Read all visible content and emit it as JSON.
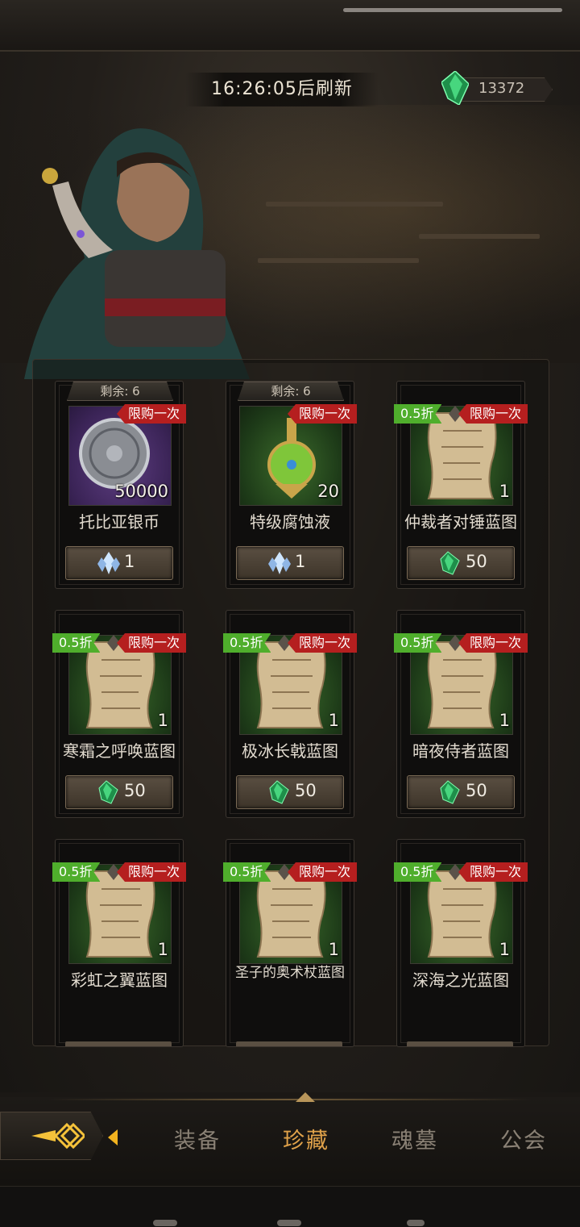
{
  "header": {
    "refresh_timer": "16:26:05后刷新",
    "gem_count": "13372"
  },
  "colors": {
    "limit_badge": "#b51f1f",
    "discount_badge": "#4fae2c",
    "active_tab": "#e0a24a",
    "inactive_tab": "#8a8175"
  },
  "items": [
    {
      "remaining": "剩余: 6",
      "limit": "限购一次",
      "discount": "",
      "quantity": "50000",
      "name": "托比亚银币",
      "price": "1",
      "currency_icon": "crystal-cluster-icon",
      "art": "silver-coin-icon"
    },
    {
      "remaining": "剩余: 6",
      "limit": "限购一次",
      "discount": "",
      "quantity": "20",
      "name": "特级腐蚀液",
      "price": "1",
      "currency_icon": "crystal-cluster-icon",
      "art": "potion-flask-icon"
    },
    {
      "remaining": "",
      "limit": "限购一次",
      "discount": "0.5折",
      "quantity": "1",
      "name": "仲裁者对锤蓝图",
      "price": "50",
      "currency_icon": "green-gem-icon",
      "art": "blueprint-scroll-icon"
    },
    {
      "remaining": "",
      "limit": "限购一次",
      "discount": "0.5折",
      "quantity": "1",
      "name": "寒霜之呼唤蓝图",
      "price": "50",
      "currency_icon": "green-gem-icon",
      "art": "blueprint-scroll-icon"
    },
    {
      "remaining": "",
      "limit": "限购一次",
      "discount": "0.5折",
      "quantity": "1",
      "name": "极冰长戟蓝图",
      "price": "50",
      "currency_icon": "green-gem-icon",
      "art": "blueprint-scroll-icon"
    },
    {
      "remaining": "",
      "limit": "限购一次",
      "discount": "0.5折",
      "quantity": "1",
      "name": "暗夜侍者蓝图",
      "price": "50",
      "currency_icon": "green-gem-icon",
      "art": "blueprint-scroll-icon"
    },
    {
      "remaining": "",
      "limit": "限购一次",
      "discount": "0.5折",
      "quantity": "1",
      "name": "彩虹之翼蓝图",
      "price": "",
      "currency_icon": "",
      "art": "blueprint-scroll-icon"
    },
    {
      "remaining": "",
      "limit": "限购一次",
      "discount": "0.5折",
      "quantity": "1",
      "name": "圣子的奥术杖蓝图",
      "price": "",
      "currency_icon": "",
      "art": "blueprint-scroll-icon"
    },
    {
      "remaining": "",
      "limit": "限购一次",
      "discount": "0.5折",
      "quantity": "1",
      "name": "深海之光蓝图",
      "price": "",
      "currency_icon": "",
      "art": "blueprint-scroll-icon"
    }
  ],
  "tabs": [
    {
      "label": "装备",
      "active": false
    },
    {
      "label": "珍藏",
      "active": true
    },
    {
      "label": "魂墓",
      "active": false
    },
    {
      "label": "公会",
      "active": false
    }
  ]
}
